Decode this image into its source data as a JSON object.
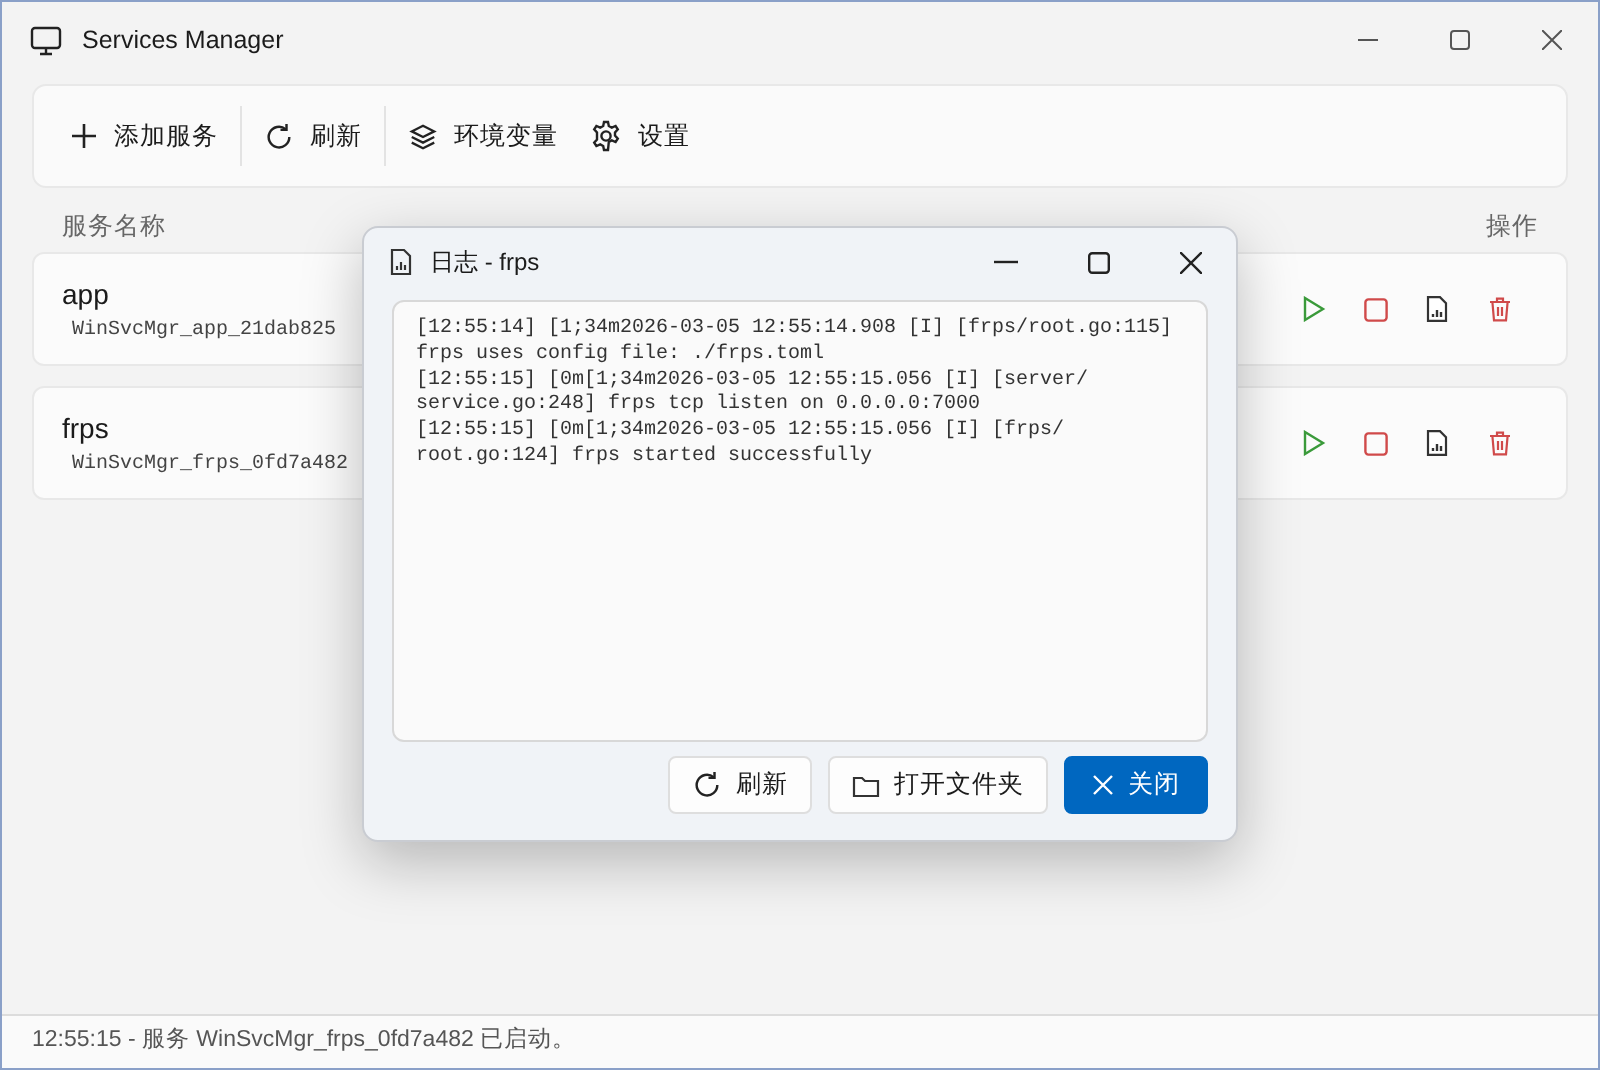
{
  "window": {
    "title": "Services Manager"
  },
  "toolbar": [
    {
      "kind": "add",
      "label": "添加服务"
    },
    {
      "kind": "refresh",
      "label": "刷新"
    },
    {
      "kind": "env",
      "label": "环境变量"
    },
    {
      "kind": "settings",
      "label": "设置"
    }
  ],
  "table": {
    "columns": [
      "服务名称",
      "操作"
    ],
    "rows": [
      {
        "name": "app",
        "service_id": "WinSvcMgr_app_21dab825"
      },
      {
        "name": "frps",
        "service_id": "WinSvcMgr_frps_0fd7a482"
      }
    ]
  },
  "dialog": {
    "title": "日志 - frps",
    "log_lines": [
      "[12:55:14] [1;34m2026-03-05 12:55:14.908 [I] [frps/root.go:115]",
      "frps uses config file: ./frps.toml",
      "[12:55:15] [0m[1;34m2026-03-05 12:55:15.056 [I] [server/",
      "service.go:248] frps tcp listen on 0.0.0.0:7000",
      "[12:55:15] [0m[1;34m2026-03-05 12:55:15.056 [I] [frps/",
      "root.go:124] frps started successfully"
    ],
    "buttons": [
      {
        "kind": "refresh",
        "label": "刷新",
        "primary": false
      },
      {
        "kind": "folder",
        "label": "打开文件夹",
        "primary": false
      },
      {
        "kind": "close",
        "label": "关闭",
        "primary": true
      }
    ]
  },
  "status_bar": "12:55:15 - 服务 WinSvcMgr_frps_0fd7a482 已启动。"
}
